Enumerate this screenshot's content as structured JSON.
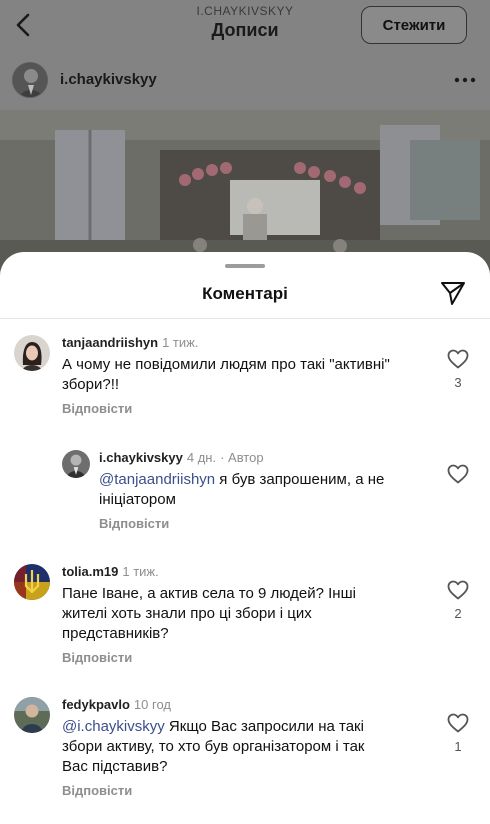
{
  "header": {
    "username_caps": "I.CHAYKIVSKYY",
    "title": "Дописи",
    "follow_label": "Стежити",
    "back_icon": "chevron-left-icon",
    "more_icon": "more-horizontal-icon"
  },
  "post": {
    "author": "i.chaykivskyy"
  },
  "comments_sheet": {
    "title": "Коментарі",
    "share_icon": "send-icon",
    "comments": [
      {
        "user": "tanjaandriishyn",
        "time": "1 тиж.",
        "text": "А чому не повідомили людям про такі \"активні\" збори?!!",
        "reply_label": "Відповісти",
        "likes": "3"
      },
      {
        "user": "i.chaykivskyy",
        "time": "4 дн.",
        "author_badge": "· Автор",
        "mention": "@tanjaandriishyn",
        "text": " я був запрошеним, а не ініціатором",
        "reply_label": "Відповісти",
        "likes": ""
      },
      {
        "user": "tolia.m19",
        "time": "1 тиж.",
        "text": "Пане Іване, а актив села то 9 людей? Інші жителі хоть знали про ці збори і цих представників?",
        "reply_label": "Відповісти",
        "likes": "2"
      },
      {
        "user": "fedykpavlo",
        "time": "10 год",
        "mention": "@i.chaykivskyy",
        "text": " Якщо Вас запросили на такі збори активу, то хто був організатором і так Вас підставив?",
        "reply_label": "Відповісти",
        "likes": "1"
      }
    ]
  },
  "colors": {
    "dim_overlay": "#838383",
    "sheet_bg": "#ffffff",
    "mention": "#3b4f8c",
    "secondary_text": "#8e8e8e"
  }
}
